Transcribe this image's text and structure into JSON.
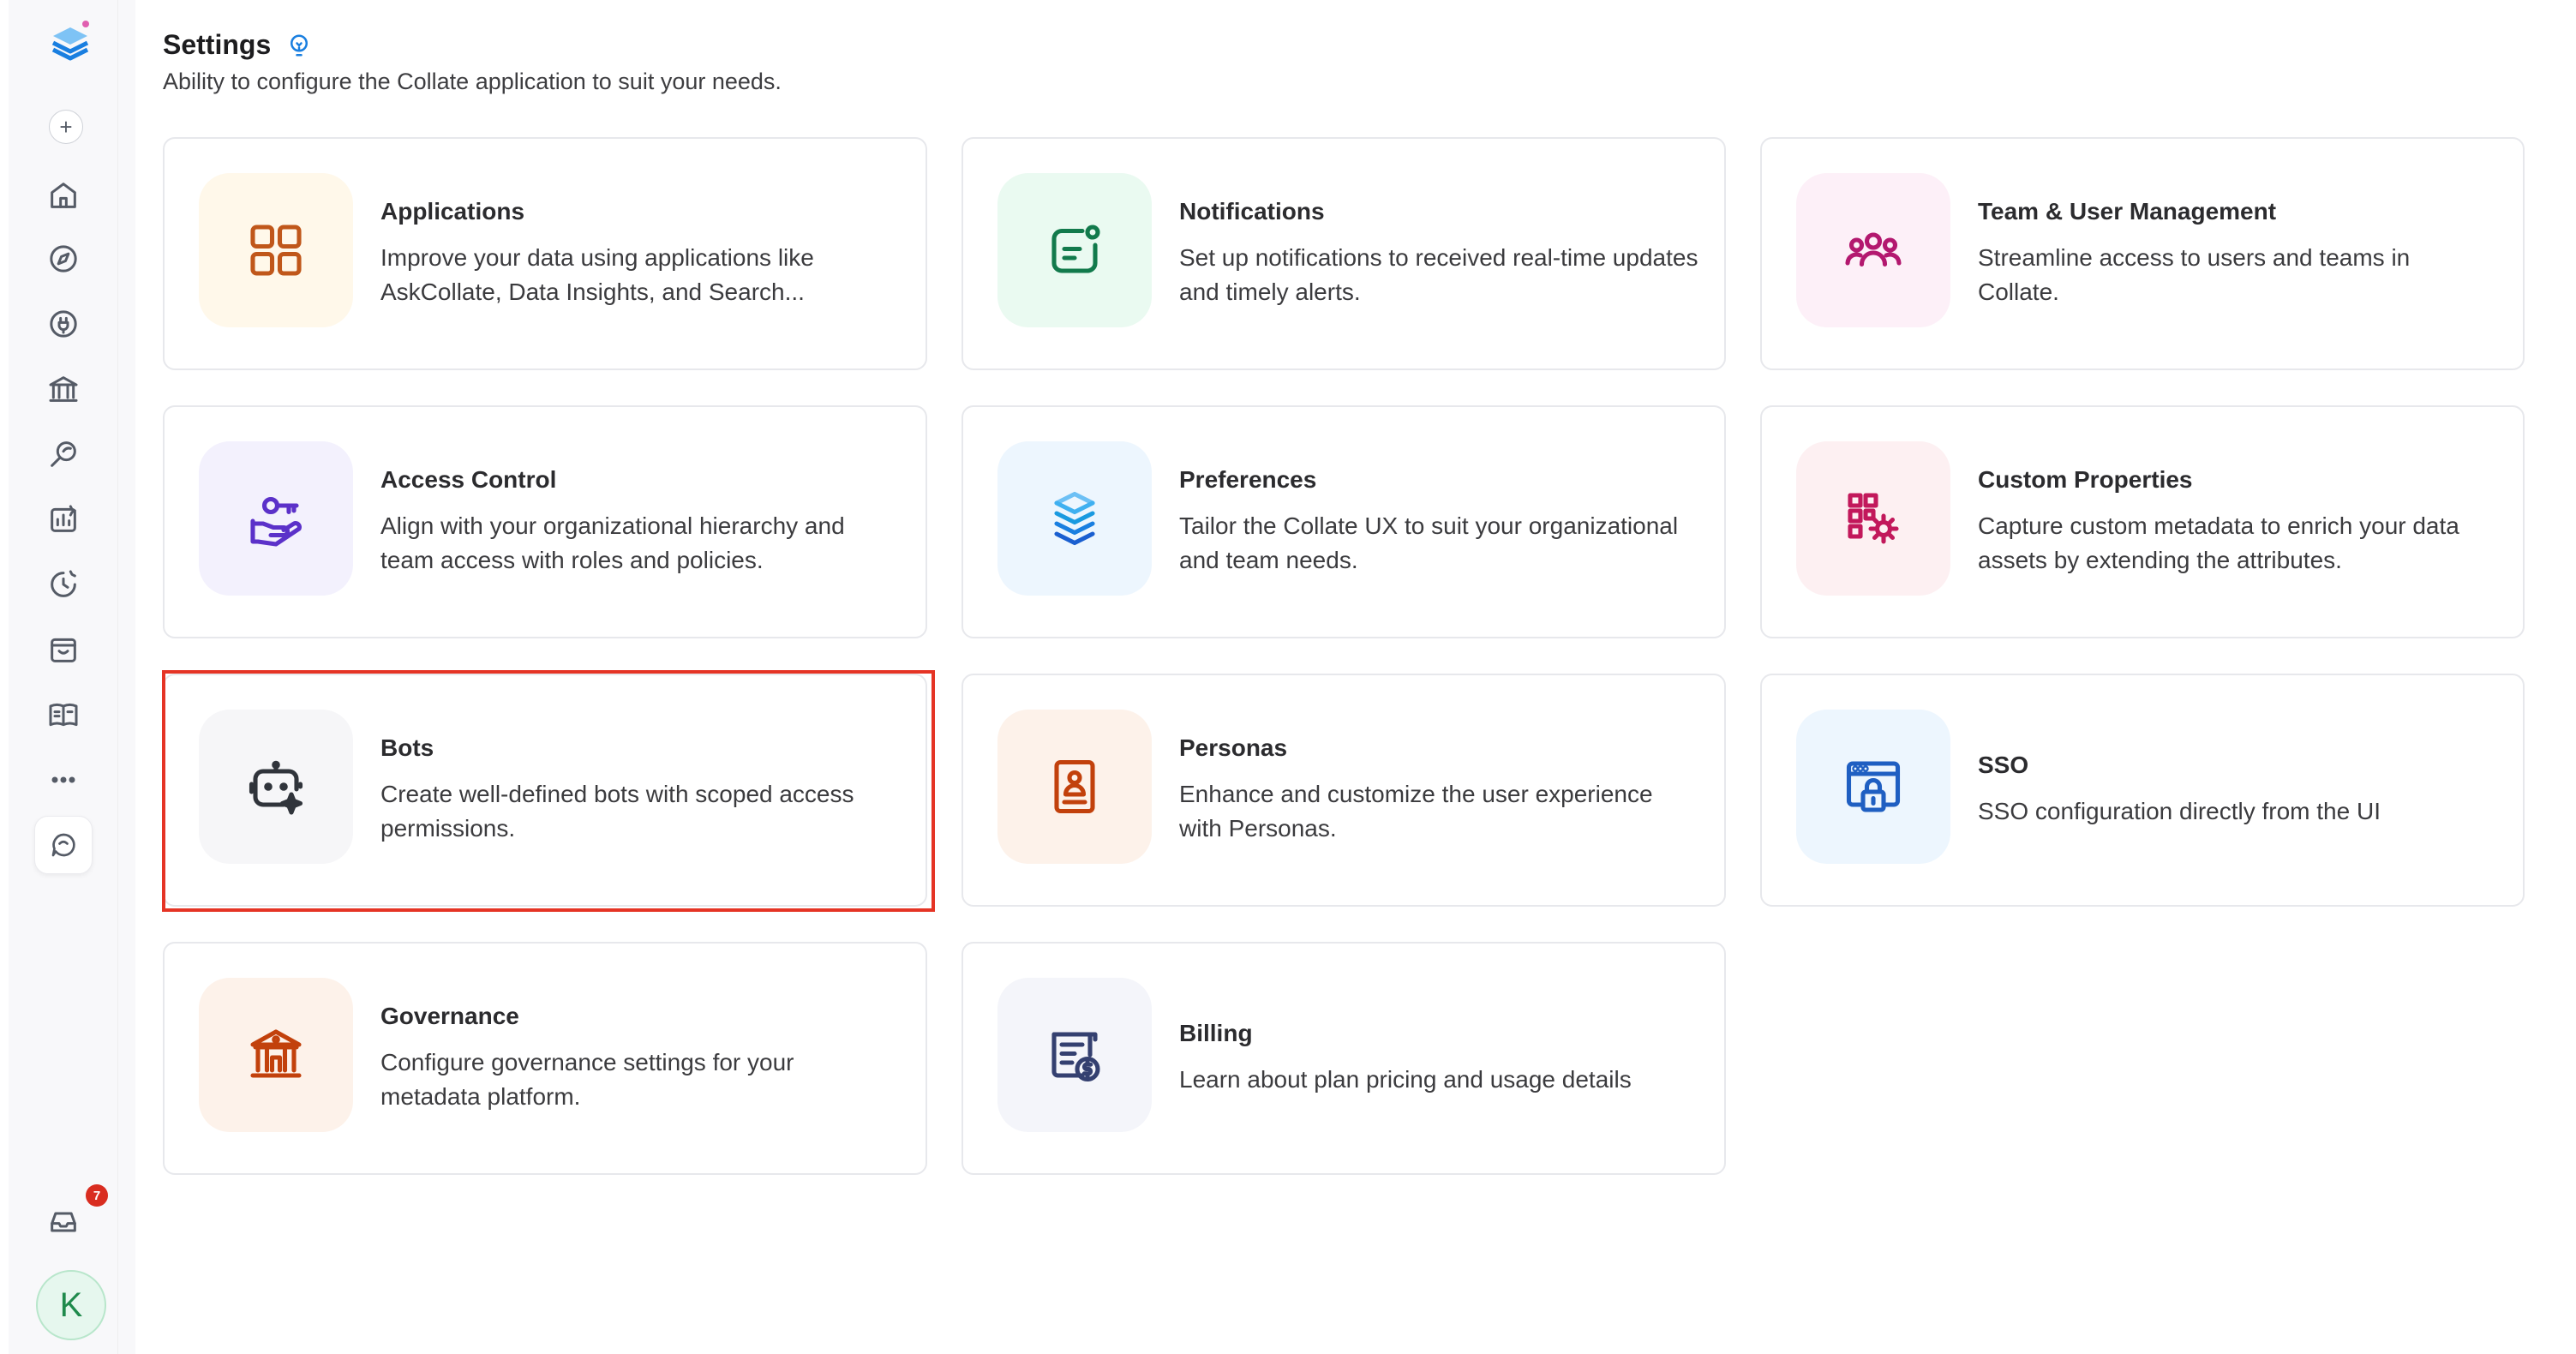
{
  "header": {
    "title": "Settings",
    "subtitle": "Ability to configure the Collate application to suit your needs."
  },
  "sidebar": {
    "items": [
      {
        "icon": "home-icon"
      },
      {
        "icon": "compass-icon"
      },
      {
        "icon": "plug-icon"
      },
      {
        "icon": "bank-icon"
      },
      {
        "icon": "search-leaf-icon"
      },
      {
        "icon": "chart-icon"
      },
      {
        "icon": "clock-icon"
      },
      {
        "icon": "store-icon"
      },
      {
        "icon": "book-icon"
      },
      {
        "icon": "more-icon"
      },
      {
        "icon": "chat-icon"
      }
    ],
    "notification_count": "7",
    "avatar_initial": "K"
  },
  "cards": [
    {
      "title": "Applications",
      "desc": "Improve your data using applications like AskCollate, Data Insights, and Search...",
      "icon": "apps-grid-icon",
      "bg": "#fff8ea",
      "color": "#c0571a"
    },
    {
      "title": "Notifications",
      "desc": "Set up notifications to received real-time updates and timely alerts.",
      "icon": "notification-icon",
      "bg": "#eafaf1",
      "color": "#127a4c"
    },
    {
      "title": "Team & User Management",
      "desc": "Streamline access to users and teams in Collate.",
      "icon": "team-icon",
      "bg": "#fdf0f8",
      "color": "#b3186f"
    },
    {
      "title": "Access Control",
      "desc": "Align with your organizational hierarchy and team access with roles and policies.",
      "icon": "key-hand-icon",
      "bg": "#f3f1fd",
      "color": "#5b31c9"
    },
    {
      "title": "Preferences",
      "desc": "Tailor the Collate UX to suit your organizational and team needs.",
      "icon": "layers-icon",
      "bg": "#edf6fe",
      "color": "#1a7fe0"
    },
    {
      "title": "Custom Properties",
      "desc": "Capture custom metadata to enrich your data assets by extending the attributes.",
      "icon": "grid-gear-icon",
      "bg": "#fdf0f2",
      "color": "#c2185b"
    },
    {
      "title": "Bots",
      "desc": "Create well-defined bots with scoped access permissions.",
      "icon": "bot-icon",
      "bg": "#f6f6f8",
      "color": "#30343b"
    },
    {
      "title": "Personas",
      "desc": "Enhance and customize the user experience with Personas.",
      "icon": "persona-icon",
      "bg": "#fdf2ea",
      "color": "#c2410c"
    },
    {
      "title": "SSO",
      "desc": "SSO configuration directly from the UI",
      "icon": "sso-lock-icon",
      "bg": "#edf6fe",
      "color": "#1f5fc2"
    },
    {
      "title": "Governance",
      "desc": "Configure governance settings for your metadata platform.",
      "icon": "governance-icon",
      "bg": "#fdf2ea",
      "color": "#c2410c"
    },
    {
      "title": "Billing",
      "desc": "Learn about plan pricing and usage details",
      "icon": "billing-icon",
      "bg": "#f4f5fa",
      "color": "#344070"
    }
  ]
}
